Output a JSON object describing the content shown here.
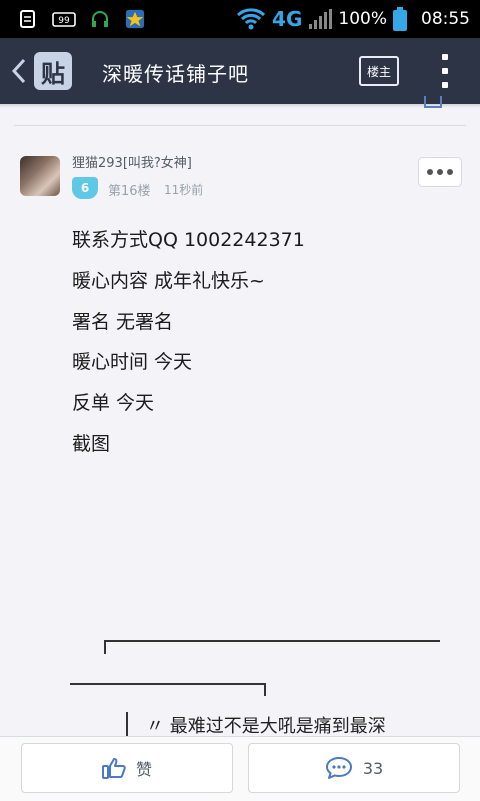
{
  "status_bar": {
    "signal_type": "4G",
    "battery": "100%",
    "time": "08:55",
    "left_icons": [
      "file-icon",
      "badge-99-icon",
      "headset-icon",
      "star-app-icon"
    ]
  },
  "topbar": {
    "logo_text": "贴",
    "title": "深暖传话铺子吧",
    "owner_label": "楼主"
  },
  "post": {
    "username": "狸猫293[叫我?女神]",
    "level": "6",
    "floor": "第16楼",
    "time_ago": "11秒前",
    "lines": [
      "联系方式QQ 1002242371",
      "暖心内容 成年礼快乐~",
      "署名 无署名",
      "暖心时间 今天",
      "反单 今天",
      "截图"
    ],
    "quote_text": "〃  最难过不是大吼是痛到最深"
  },
  "bottom_bar": {
    "like_label": "赞",
    "comment_count": "33"
  },
  "colors": {
    "topbar": "#2c3446",
    "level_badge": "#5ec8e6",
    "icon_blue": "#4a79c7"
  }
}
